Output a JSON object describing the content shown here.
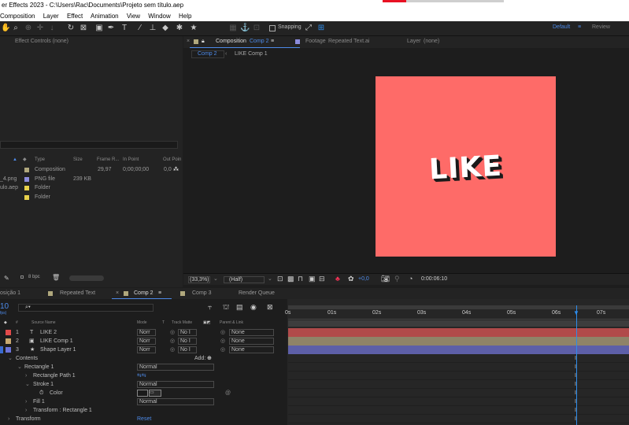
{
  "titlebar": {
    "text": "er Effects 2023 - C:\\Users\\Rac\\Documents\\Projeto sem título.aep"
  },
  "menu": [
    "Composition",
    "Layer",
    "Effect",
    "Animation",
    "View",
    "Window",
    "Help"
  ],
  "toolbar": {
    "snapping_label": "Snapping",
    "workspaces": [
      "Default",
      "≡",
      "Review"
    ]
  },
  "effect_controls": {
    "title": "Effect Controls (none)"
  },
  "viewer": {
    "tabs": [
      "Composition",
      "Comp 2",
      "≡",
      "Footage",
      "Repeated Text.ai",
      "Layer",
      "(none)"
    ],
    "breadcrumbs": [
      "Comp 2",
      "LIKE Comp 1"
    ],
    "comp_text": "LIKE",
    "comp_bg": "#fe6b68",
    "footer": {
      "zoom": "(33,3%)",
      "quality": "(Half)",
      "exposure": "+0,0",
      "timecode": "0:00:06:10"
    }
  },
  "project": {
    "columns": [
      "Type",
      "Size",
      "Frame R...",
      "In Point",
      "Out Poin"
    ],
    "rows": [
      {
        "name": "",
        "type": "Composition",
        "size": "",
        "fps": "29,97",
        "in": "0;00;00;00",
        "out": "0,0",
        "color": "#b0a87d"
      },
      {
        "name": "_4.png",
        "type": "PNG file",
        "size": "239 KB",
        "fps": "",
        "in": "",
        "out": "",
        "color": "#8c8cdc"
      },
      {
        "name": "ulo.aep",
        "type": "Folder",
        "size": "",
        "fps": "",
        "in": "",
        "out": "",
        "color": "#e6d04b"
      },
      {
        "name": "",
        "type": "Folder",
        "size": "",
        "fps": "",
        "in": "",
        "out": "",
        "color": "#e6d04b"
      }
    ],
    "footer_bpc": "8 bpc"
  },
  "timeline": {
    "tabs": [
      "osição 1",
      "Repeated Text",
      "Comp 2",
      "≡",
      "Comp 3",
      "Render Queue"
    ],
    "current_time": "10",
    "fps_small": "fps)",
    "search_placeholder": "⌕▾",
    "columns": {
      "num": "#",
      "source": "Source Name",
      "mode": "Mode",
      "t": "T",
      "trkmat": "Track Matte",
      "parent": "Parent & Link"
    },
    "layers": [
      {
        "num": "1",
        "icon": "T",
        "name": "LIKE 2",
        "mode": "Norr",
        "matte": "No I",
        "parent": "None",
        "color": "#e34a4a"
      },
      {
        "num": "2",
        "icon": "▣",
        "name": "LIKE Comp 1",
        "mode": "Norr",
        "matte": "No I",
        "parent": "None",
        "color": "#c8a96f"
      },
      {
        "num": "3",
        "icon": "★",
        "name": "Shape Layer 1",
        "mode": "Norr",
        "matte": "No I",
        "parent": "None",
        "color": "#6c74d9"
      }
    ],
    "props": [
      {
        "label": "Contents",
        "extra": "Add:",
        "indent": 1
      },
      {
        "label": "Rectangle 1",
        "extra": "Normal",
        "indent": 2
      },
      {
        "label": "Rectangle Path 1",
        "extra": "",
        "indent": 3
      },
      {
        "label": "Stroke 1",
        "extra": "Normal",
        "indent": 3
      },
      {
        "label": "Color",
        "extra": "",
        "indent": 5
      },
      {
        "label": "Fill 1",
        "extra": "Normal",
        "indent": 3
      },
      {
        "label": "Transform : Rectangle 1",
        "extra": "",
        "indent": 3
      },
      {
        "label": "Transform",
        "extra": "Reset",
        "indent": 1
      }
    ],
    "ruler": [
      "0s",
      "01s",
      "02s",
      "03s",
      "04s",
      "05s",
      "06s",
      "07s"
    ],
    "playhead_seconds": 6.33,
    "colors": {
      "bar_red": "#b14a4a",
      "bar_tan": "#8f8368",
      "bar_blue": "#5d5fa8",
      "playhead": "#2d8ceb",
      "accent": "#2d8ceb"
    }
  }
}
